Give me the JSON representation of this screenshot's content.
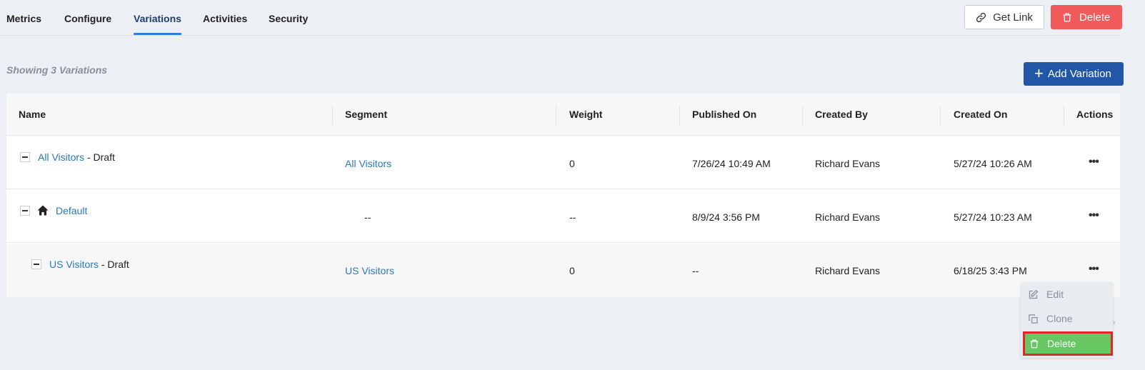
{
  "tabs": [
    "Metrics",
    "Configure",
    "Variations",
    "Activities",
    "Security"
  ],
  "active_tab": "Variations",
  "header_buttons": {
    "get_link": "Get Link",
    "delete": "Delete"
  },
  "summary_text": "Showing 3 Variations",
  "add_variation_label": "Add Variation",
  "table": {
    "columns": [
      "Name",
      "Segment",
      "Weight",
      "Published On",
      "Created By",
      "Created On",
      "Actions"
    ],
    "rows": [
      {
        "name": "All Visitors",
        "status": " - Draft",
        "segment": "All Visitors",
        "weight": "0",
        "published_on": "7/26/24 10:49 AM",
        "created_by": "Richard Evans",
        "created_on": "5/27/24 10:26 AM",
        "actions": "•••"
      },
      {
        "name": "Default",
        "status": "",
        "segment": "--",
        "weight": "--",
        "published_on": "8/9/24 3:56 PM",
        "created_by": "Richard Evans",
        "created_on": "5/27/24 10:23 AM",
        "actions": "•••"
      },
      {
        "name": "US Visitors",
        "status": " - Draft",
        "segment": "US Visitors",
        "weight": "0",
        "published_on": "--",
        "created_by": "Richard Evans",
        "created_on": "6/18/25 3:43 PM",
        "actions": "•••"
      }
    ]
  },
  "actions_menu": {
    "edit": "Edit",
    "clone": "Clone",
    "delete": "Delete"
  },
  "colors": {
    "primary": "#2257a8",
    "danger": "#f15b5b",
    "link": "#2c79b8",
    "highlight": "#68c763",
    "highlight_border": "#e0262b",
    "active_tab_underline": "#2f7fdc"
  }
}
